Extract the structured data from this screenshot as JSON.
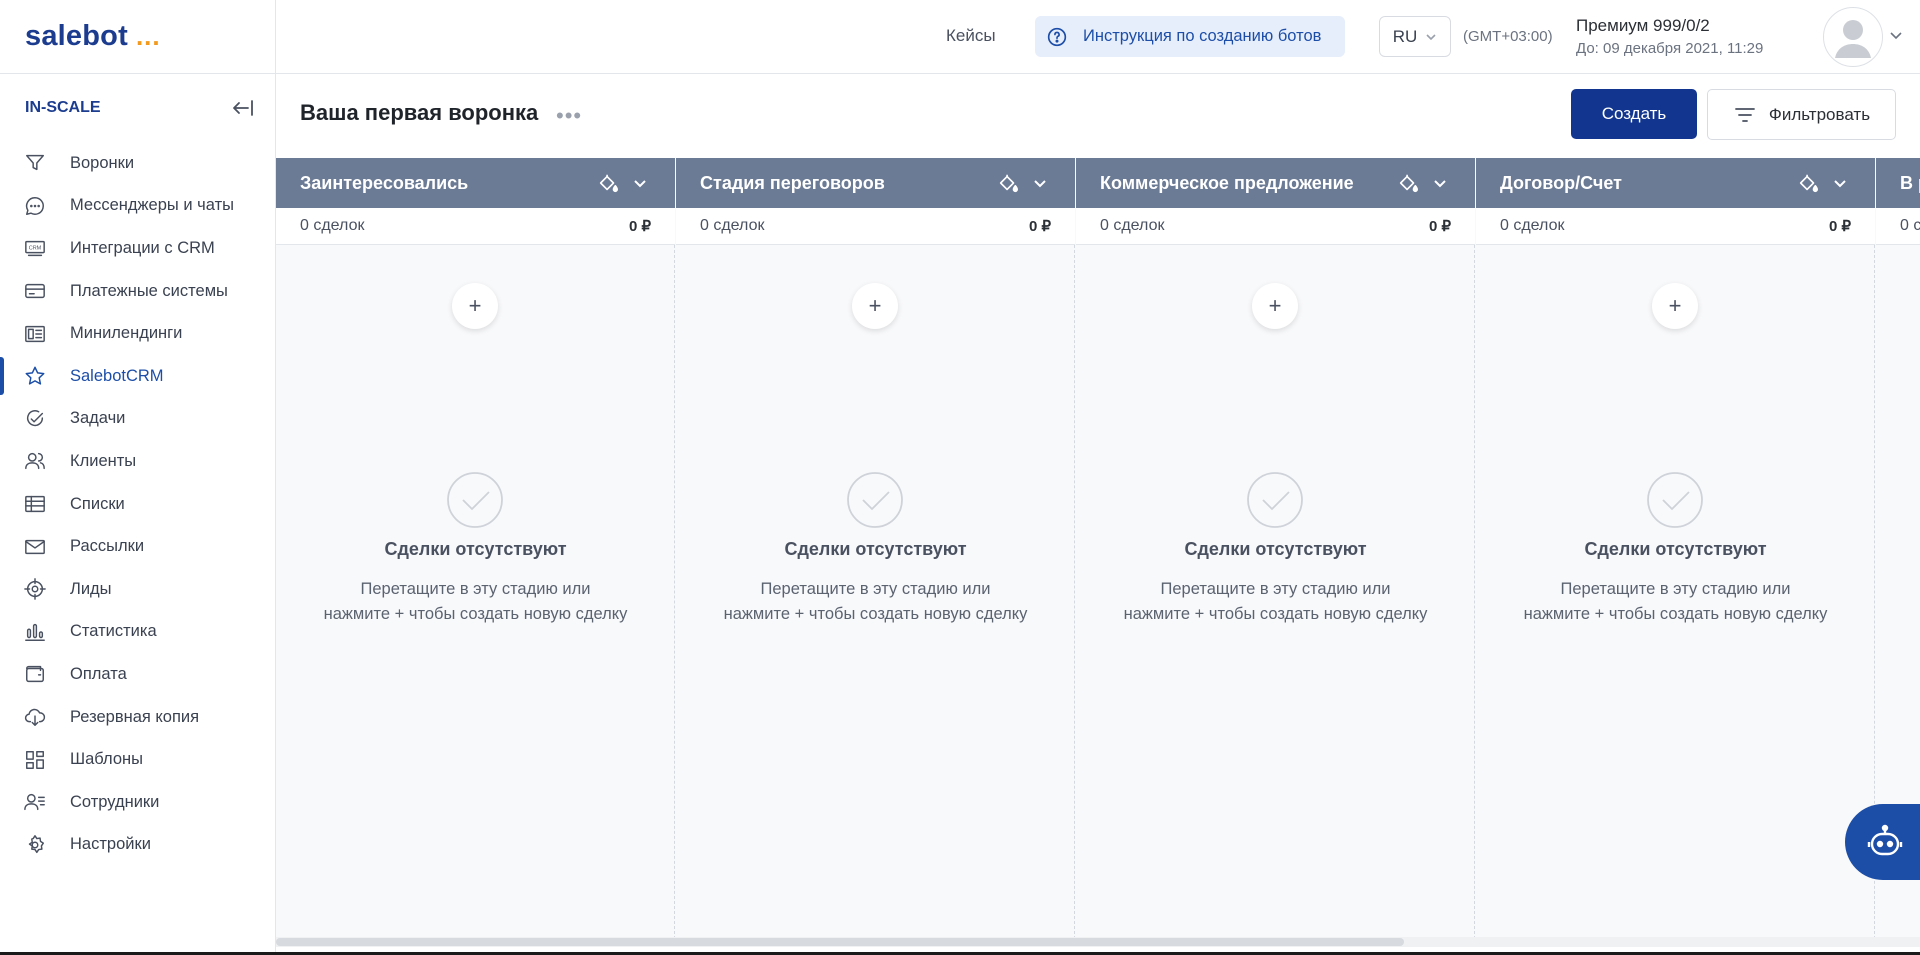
{
  "brand": {
    "name": "salebot",
    "dots": "...",
    "accent": "#1c3d8f",
    "dots_color": "#f29a1d"
  },
  "workspace": "IN-SCALE",
  "sidebar": {
    "items": [
      {
        "label": "Воронки",
        "icon": "filter-icon"
      },
      {
        "label": "Мессенджеры и чаты",
        "icon": "chat-icon"
      },
      {
        "label": "Интеграции с CRM",
        "icon": "crm-icon"
      },
      {
        "label": "Платежные системы",
        "icon": "card-icon"
      },
      {
        "label": "Минилендинги",
        "icon": "landing-icon"
      },
      {
        "label": "SalebotCRM",
        "icon": "star-icon",
        "active": true
      },
      {
        "label": "Задачи",
        "icon": "check-circle-icon"
      },
      {
        "label": "Клиенты",
        "icon": "users-icon"
      },
      {
        "label": "Списки",
        "icon": "table-icon"
      },
      {
        "label": "Рассылки",
        "icon": "mail-icon"
      },
      {
        "label": "Лиды",
        "icon": "target-icon"
      },
      {
        "label": "Статистика",
        "icon": "chart-icon"
      },
      {
        "label": "Оплата",
        "icon": "wallet-icon"
      },
      {
        "label": "Резервная копия",
        "icon": "cloud-download-icon"
      },
      {
        "label": "Шаблоны",
        "icon": "templates-icon"
      },
      {
        "label": "Сотрудники",
        "icon": "staff-icon"
      },
      {
        "label": "Настройки",
        "icon": "gear-icon"
      }
    ]
  },
  "header": {
    "cases": "Кейсы",
    "guide": "Инструкция по созданию ботов",
    "lang": "RU",
    "timezone": "(GMT+03:00)",
    "plan": "Премиум 999/0/2",
    "plan_until": "До: 09 декабря 2021, 11:29"
  },
  "page": {
    "title": "Ваша первая воронка",
    "more": "•••",
    "create": "Создать",
    "filter": "Фильтровать"
  },
  "board": {
    "header_color": "#6b7a95",
    "columns": [
      {
        "name": "Заинтересовались",
        "deals": "0 сделок",
        "sum": "0 ₽",
        "add": "+",
        "empty_title": "Сделки отсутствуют",
        "empty_line1": "Перетащите в эту стадию или",
        "empty_line2": "нажмите + чтобы создать новую сделку"
      },
      {
        "name": "Стадия переговоров",
        "deals": "0 сделок",
        "sum": "0 ₽",
        "add": "+",
        "empty_title": "Сделки отсутствуют",
        "empty_line1": "Перетащите в эту стадию или",
        "empty_line2": "нажмите + чтобы создать новую сделку"
      },
      {
        "name": "Коммерческое предложение",
        "deals": "0 сделок",
        "sum": "0 ₽",
        "add": "+",
        "empty_title": "Сделки отсутствуют",
        "empty_line1": "Перетащите в эту стадию или",
        "empty_line2": "нажмите + чтобы создать новую сделку"
      },
      {
        "name": "Договор/Счет",
        "deals": "0 сделок",
        "sum": "0 ₽",
        "add": "+",
        "empty_title": "Сделки отсутствуют",
        "empty_line1": "Перетащите в эту стадию или",
        "empty_line2": "нажмите + чтобы создать новую сделку"
      },
      {
        "name": "В р",
        "deals": "0 с",
        "sum": "",
        "add": "",
        "empty_title": "",
        "empty_line1": "",
        "empty_line2": ""
      }
    ]
  }
}
